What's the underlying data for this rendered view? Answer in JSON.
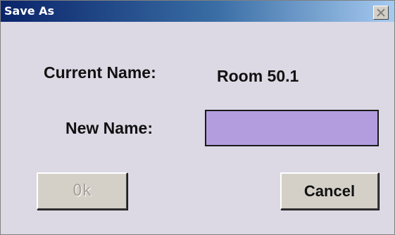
{
  "window": {
    "title": "Save As",
    "titlebar_colors": [
      "#0a246a",
      "#a6caf0"
    ],
    "background": "#dcd8e4"
  },
  "fields": {
    "current_name_label": "Current Name:",
    "current_name_value": "Room 50.1",
    "new_name_label": "New Name:",
    "new_name_value": "",
    "new_name_bg": "#b39ddf"
  },
  "buttons": {
    "ok_label": "Ok",
    "ok_enabled": false,
    "cancel_label": "Cancel"
  },
  "icons": {
    "close": "close-icon"
  }
}
